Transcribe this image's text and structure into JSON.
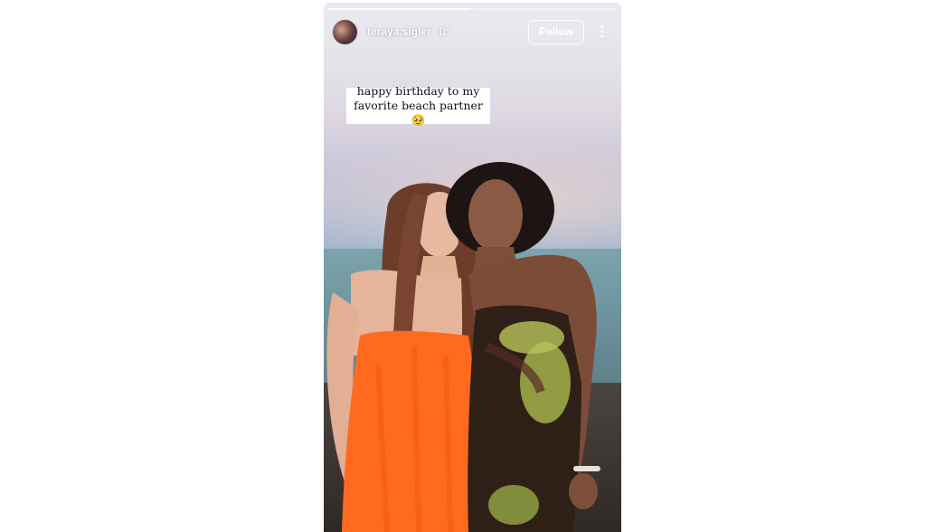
{
  "story": {
    "progress": {
      "segments": 2,
      "completed": 1
    },
    "user": {
      "username": "teraya.sigler",
      "time": "1h"
    },
    "follow_label": "Follow",
    "more_icon": "more-vertical-icon",
    "caption": {
      "line1": "happy birthday to my",
      "line2": "favorite beach partner 🥹"
    },
    "photo_description": "Two women standing by the sea at sunset"
  }
}
